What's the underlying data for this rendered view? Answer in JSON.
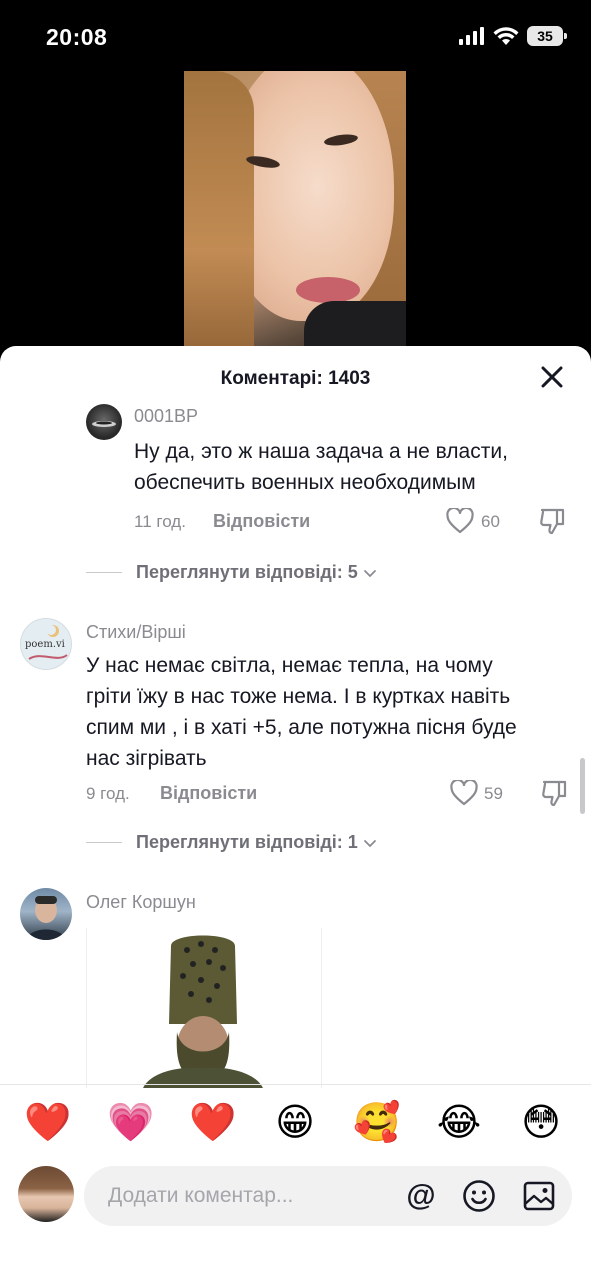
{
  "status_bar": {
    "time": "20:08",
    "battery": "35"
  },
  "sheet": {
    "title": "Коментарі: 1403"
  },
  "comments": [
    {
      "username": "0001BP",
      "text_lines": [
        "Ну да, это ж наша задача а не власти,",
        "обеспечить военных необходимым"
      ],
      "time": "11 год.",
      "reply_label": "Відповісти",
      "likes": "60",
      "view_replies": "Переглянути відповіді: 5"
    },
    {
      "username": "Стихи/Вірші",
      "avatar_text": "poem.vi",
      "text_lines": [
        "У нас немає світла, немає тепла, на чому",
        "гріти їжу в нас тоже нема. І в куртках навіть",
        "спим ми , і в хаті +5, але потужна пісня буде",
        "нас зігрівать"
      ],
      "time": "9 год.",
      "reply_label": "Відповісти",
      "likes": "59",
      "view_replies": "Переглянути відповіді: 1"
    },
    {
      "username": "Олег Коршун"
    }
  ],
  "emojis": [
    "❤️",
    "💗",
    "❤️",
    "😁",
    "🥰",
    "😂",
    "😳"
  ],
  "input": {
    "placeholder": "Додати коментар..."
  },
  "icons": {
    "close": "close-icon",
    "like": "heart-outline-icon",
    "dislike": "thumbs-down-icon",
    "chevron": "chevron-down-icon",
    "mention": "at-icon",
    "emoji": "smile-icon",
    "image": "image-icon"
  }
}
